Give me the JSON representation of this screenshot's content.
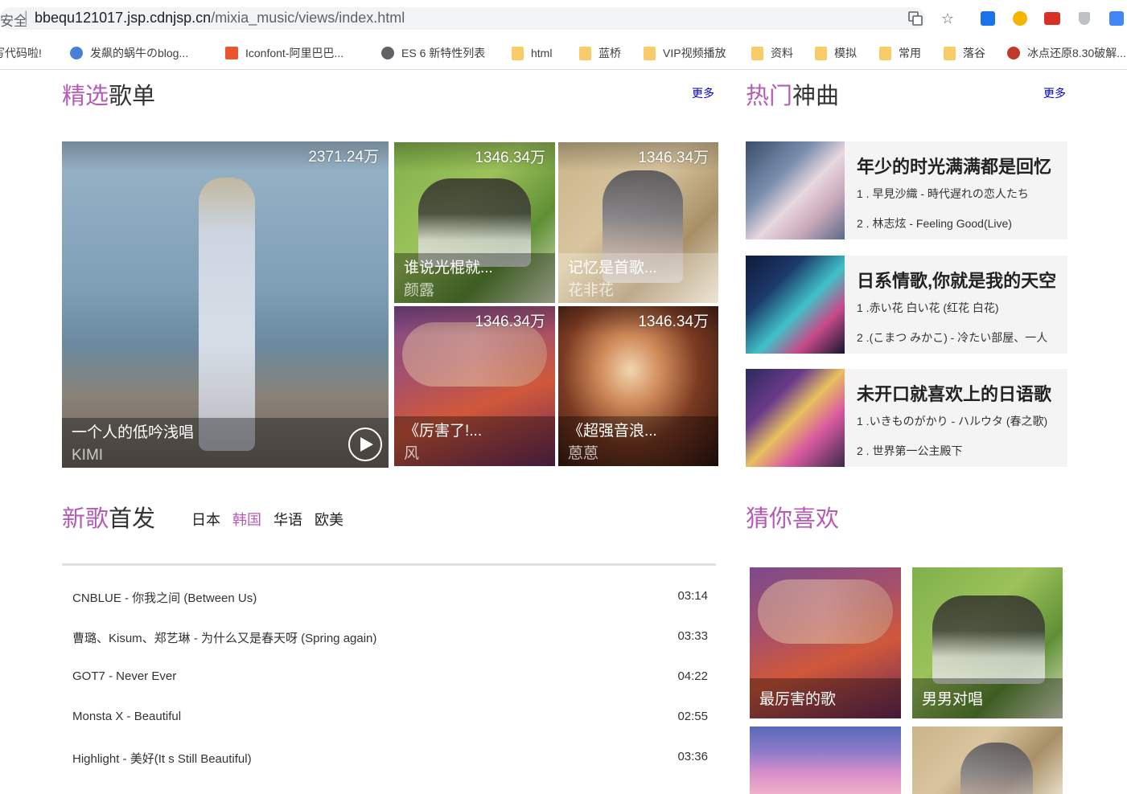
{
  "browser": {
    "security": "安全",
    "url_host": "bbequ121017.jsp.cdnjsp.cn",
    "url_path": "/mixia_music/views/index.html"
  },
  "bookmarks": [
    {
      "label": "写代码啦!",
      "icon": "site-icon"
    },
    {
      "label": "发飙的蜗牛のblog...",
      "icon": "site-icon"
    },
    {
      "label": "Iconfont-阿里巴巴...",
      "icon": "iconfont-icon"
    },
    {
      "label": "ES 6 新特性列表",
      "icon": "globe-icon"
    },
    {
      "label": "html",
      "icon": "folder-icon"
    },
    {
      "label": "蓝桥",
      "icon": "folder-icon"
    },
    {
      "label": "VIP视频播放",
      "icon": "folder-icon"
    },
    {
      "label": "资料",
      "icon": "folder-icon"
    },
    {
      "label": "模拟",
      "icon": "folder-icon"
    },
    {
      "label": "常用",
      "icon": "folder-icon"
    },
    {
      "label": "落谷",
      "icon": "folder-icon"
    },
    {
      "label": "冰点还原8.30破解...",
      "icon": "site-icon"
    }
  ],
  "featured": {
    "title_a": "精选",
    "title_b": "歌单",
    "more": "更多",
    "main": {
      "count": "2371.24万",
      "name": "一个人的低吟浅唱",
      "artist": "KIMI"
    },
    "items": [
      {
        "count": "1346.34万",
        "name": "谁说光棍就...",
        "artist": "颜露"
      },
      {
        "count": "1346.34万",
        "name": "记忆是首歌...",
        "artist": "花非花"
      },
      {
        "count": "1346.34万",
        "name": "《厉害了!...",
        "artist": "风"
      },
      {
        "count": "1346.34万",
        "name": "《超强音浪...",
        "artist": "蒽蒽"
      }
    ]
  },
  "hot": {
    "title_a": "热门",
    "title_b": "神曲",
    "more": "更多",
    "items": [
      {
        "title": "年少的时光满满都是回忆",
        "s1": "1 . 早見沙織 - 時代遅れの恋人たち",
        "s2": "2 . 林志炫 - Feeling Good(Live)"
      },
      {
        "title": "日系情歌,你就是我的天空",
        "s1": "1 .赤い花 白い花 (红花 白花)",
        "s2": "2 .(こまつ みかこ) - 冷たい部屋、一人"
      },
      {
        "title": "未开口就喜欢上的日语歌",
        "s1": "1 .いきものがかり - ハルウタ (春之歌)",
        "s2": "2 . 世界第一公主殿下"
      }
    ]
  },
  "newsongs": {
    "title_a": "新歌",
    "title_b": "首发",
    "tabs": [
      "日本",
      "韩国",
      "华语",
      "欧美"
    ],
    "active_tab": "韩国",
    "songs": [
      {
        "title": "CNBLUE - 你我之间 (Between Us)",
        "duration": "03:14"
      },
      {
        "title": "曹璐、Kisum、郑艺琳 - 为什么又是春天呀 (Spring again)",
        "duration": "03:33"
      },
      {
        "title": "GOT7 - Never Ever",
        "duration": "04:22"
      },
      {
        "title": "Monsta X - Beautiful",
        "duration": "02:55"
      },
      {
        "title": "Highlight - 美好(It s Still Beautiful)",
        "duration": "03:36"
      }
    ]
  },
  "guess": {
    "title": "猜你喜欢",
    "items": [
      {
        "name": "最厉害的歌"
      },
      {
        "name": "男男对唱"
      },
      {
        "name": ""
      },
      {
        "name": ""
      }
    ]
  },
  "colors": {
    "accent": "#b45cb4",
    "link": "#0000cc"
  }
}
